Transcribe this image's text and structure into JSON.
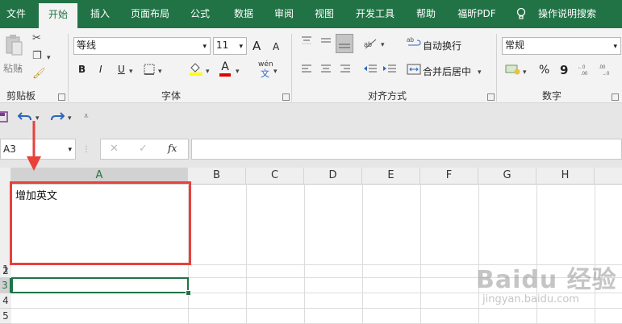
{
  "tabs": [
    "文件",
    "开始",
    "插入",
    "页面布局",
    "公式",
    "数据",
    "审阅",
    "视图",
    "开发工具",
    "帮助",
    "福昕PDF",
    "操作说明搜索"
  ],
  "clipboard": {
    "paste_label": "粘贴",
    "group_label": "剪贴板"
  },
  "font": {
    "name": "等线",
    "size": "11",
    "group_label": "字体",
    "bold": "B",
    "italic": "I",
    "underline": "U",
    "font_color_glyph": "A",
    "grow": "A",
    "shrink": "A",
    "phonetic": "wén"
  },
  "alignment": {
    "wrap_text": "自动换行",
    "merge_center": "合并后居中",
    "group_label": "对齐方式"
  },
  "number": {
    "format": "常规",
    "group_label": "数字",
    "percent": "%",
    "comma": "9"
  },
  "formula_bar": {
    "name_box": "A3",
    "fx": "fx"
  },
  "sheet": {
    "columns": [
      "A",
      "B",
      "C",
      "D",
      "E",
      "F",
      "G",
      "H"
    ],
    "rows": [
      "1",
      "2",
      "3",
      "4",
      "5"
    ],
    "cell_a1": "增加英文"
  },
  "watermark": {
    "brand": "Baidu 经验",
    "url": "jingyan.baidu.com"
  },
  "colors": {
    "accent": "#217346",
    "annotation": "#e8413a"
  }
}
